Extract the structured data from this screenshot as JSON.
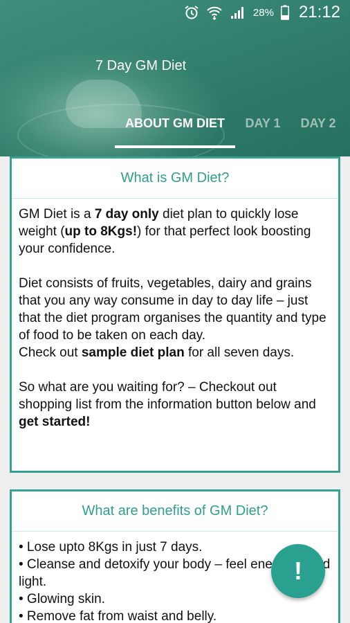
{
  "status_bar": {
    "alarm_icon": "alarm-clock-icon",
    "wifi_icon": "wifi-icon",
    "signal_icon": "cell-signal-icon",
    "battery_percent": "28%",
    "battery_icon": "battery-icon",
    "time": "21:12"
  },
  "app": {
    "title": "7 Day GM Diet"
  },
  "tabs": [
    {
      "label": "ABOUT GM DIET",
      "active": true
    },
    {
      "label": "DAY 1",
      "active": false
    },
    {
      "label": "DAY 2",
      "active": false
    }
  ],
  "card1": {
    "title": "What is GM Diet?",
    "p1": {
      "a": "GM Diet is a ",
      "b": "7 day only",
      "c": " diet plan to quickly lose weight (",
      "d": "up to 8Kgs!",
      "e": ") for that perfect look boosting your confidence."
    },
    "p2": "Diet consists of fruits, vegetables, dairy and grains that you any way consume in day to day life – just that the diet program organises the quantity and type of food to be taken on each day.",
    "p3": {
      "a": "Check out ",
      "b": "sample diet plan",
      "c": " for all seven days."
    },
    "p4": {
      "a": "So what are you waiting for? – Checkout out shopping list from the information button below and ",
      "b": "get started!"
    }
  },
  "card2": {
    "title": "What are benefits of GM Diet?",
    "items": [
      "• Lose upto 8Kgs in just 7 days.",
      " • Cleanse and detoxify your body – feel energetic and light.",
      " • Glowing skin.",
      " • Remove fat from waist and belly."
    ]
  },
  "fab": {
    "label": "!",
    "icon": "exclamation-icon"
  },
  "colors": {
    "accent": "#2aa090",
    "header": "#2f7d6a"
  }
}
